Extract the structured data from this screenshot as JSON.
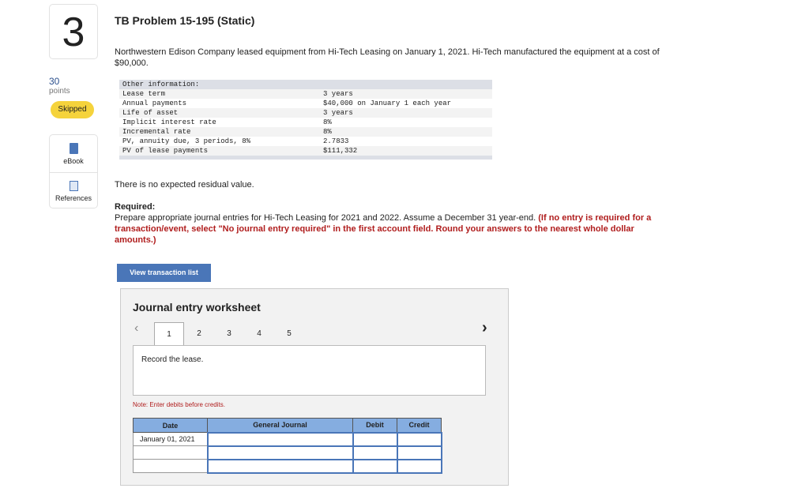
{
  "question": {
    "number": "3",
    "points": "30",
    "points_label": "points",
    "status": "Skipped"
  },
  "tools": [
    {
      "label": "eBook",
      "icon": "book-icon"
    },
    {
      "label": "References",
      "icon": "copy-icon"
    }
  ],
  "problem": {
    "title": "TB Problem 15-195 (Static)",
    "intro": "Northwestern Edison Company leased equipment from Hi-Tech Leasing on January 1, 2021. Hi-Tech manufactured the equipment at a cost of $90,000.",
    "info_header": "Other information:",
    "info": [
      [
        "Lease term",
        "3 years"
      ],
      [
        "Annual payments",
        "$40,000 on January 1 each year"
      ],
      [
        "Life of asset",
        "3 years"
      ],
      [
        "Implicit interest rate",
        "8%"
      ],
      [
        "Incremental rate",
        "8%"
      ],
      [
        "PV, annuity due, 3 periods, 8%",
        "2.7833"
      ],
      [
        "PV of lease payments",
        "$111,332"
      ]
    ],
    "residual": "There is no expected residual value.",
    "required_label": "Required:",
    "required_text": "Prepare appropriate journal entries for Hi-Tech Leasing for 2021 and 2022. Assume a December 31 year-end. ",
    "required_note": "(If no entry is required for a transaction/event, select \"No journal entry required\" in the first account field. Round your answers to the nearest whole dollar amounts.)"
  },
  "view_button": "View transaction list",
  "worksheet": {
    "title": "Journal entry worksheet",
    "tabs": [
      "1",
      "2",
      "3",
      "4",
      "5"
    ],
    "active_tab": "1",
    "description": "Record the lease.",
    "note": "Note: Enter debits before credits.",
    "columns": [
      "Date",
      "General Journal",
      "Debit",
      "Credit"
    ],
    "rows": [
      [
        "January 01, 2021",
        "",
        "",
        ""
      ],
      [
        "",
        "",
        "",
        ""
      ],
      [
        "",
        "",
        "",
        ""
      ]
    ]
  }
}
